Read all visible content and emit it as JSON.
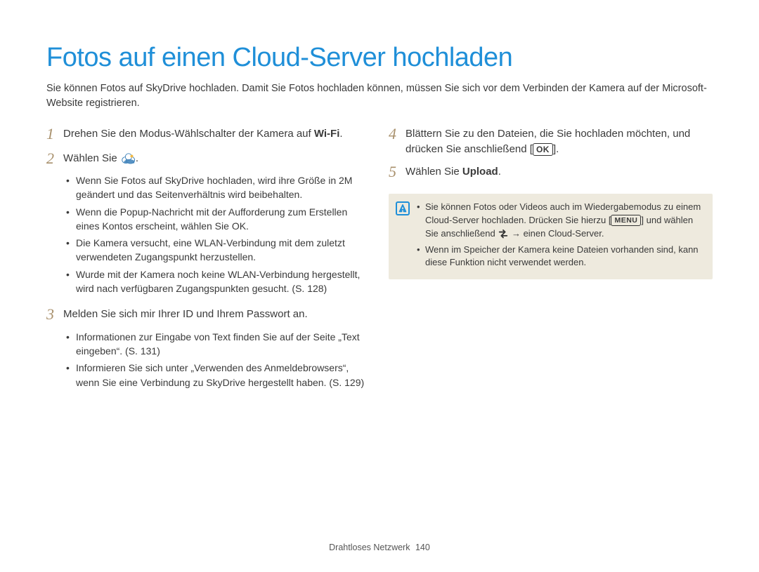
{
  "title": "Fotos auf einen Cloud-Server hochladen",
  "intro": "Sie können Fotos auf SkyDrive hochladen. Damit Sie Fotos hochladen können, müssen Sie sich vor dem Verbinden der Kamera auf der Microsoft-Website registrieren.",
  "left": {
    "step1_pre": "Drehen Sie den Modus-Wählschalter der Kamera auf ",
    "step1_bold": "Wi-Fi",
    "step1_post": ".",
    "step2": "Wählen Sie ",
    "step2_post": ".",
    "step2_bullets": [
      "Wenn Sie Fotos auf SkyDrive hochladen, wird ihre Größe in 2M geändert und das Seitenverhältnis wird beibehalten.",
      "Wenn die Popup-Nachricht mit der Aufforderung zum Erstellen eines Kontos erscheint, wählen Sie OK.",
      "Die Kamera versucht, eine WLAN-Verbindung mit dem zuletzt verwendeten Zugangspunkt herzustellen.",
      "Wurde mit der Kamera noch keine WLAN-Verbindung hergestellt, wird nach verfügbaren Zugangspunkten gesucht. (S. 128)"
    ],
    "step3": "Melden Sie sich mir Ihrer ID und Ihrem Passwort an.",
    "step3_bullets": [
      "Informationen zur Eingabe von Text finden Sie auf der Seite „Text eingeben“. (S. 131)",
      "Informieren Sie sich unter „Verwenden des Anmeldebrowsers“, wenn Sie eine Verbindung zu SkyDrive hergestellt haben. (S. 129)"
    ]
  },
  "right": {
    "step4_pre": "Blättern Sie zu den Dateien, die Sie hochladen möchten, und drücken Sie anschließend [",
    "step4_ok": "OK",
    "step4_post": "].",
    "step5_pre": "Wählen Sie ",
    "step5_bold": "Upload",
    "step5_post": ".",
    "note": {
      "line1_pre": "Sie können Fotos oder Videos auch im Wiedergabemodus zu einem Cloud-Server hochladen. Drücken Sie hierzu [",
      "line1_menu": "MENU",
      "line1_mid": "] und wählen Sie anschließend ",
      "line1_post": " → einen Cloud-Server.",
      "line2": "Wenn im Speicher der Kamera keine Dateien vorhanden sind, kann diese Funktion nicht verwendet werden."
    }
  },
  "footer": {
    "section": "Drahtloses Netzwerk",
    "page": "140"
  }
}
